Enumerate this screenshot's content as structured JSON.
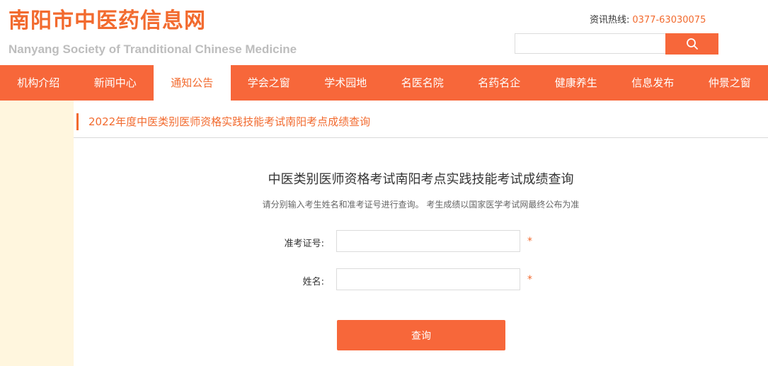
{
  "header": {
    "title": "南阳市中医药信息网",
    "subtitle": "Nanyang Society of Tranditional Chinese Medicine",
    "hotline_label": "资讯热线:",
    "hotline_number": "0377-63030075"
  },
  "search": {
    "value": "",
    "placeholder": "",
    "icon": "search-icon"
  },
  "nav": {
    "items": [
      {
        "label": "机构介绍"
      },
      {
        "label": "新闻中心"
      },
      {
        "label": "通知公告"
      },
      {
        "label": "学会之窗"
      },
      {
        "label": "学术园地"
      },
      {
        "label": "名医名院"
      },
      {
        "label": "名药名企"
      },
      {
        "label": "健康养生"
      },
      {
        "label": "信息发布"
      },
      {
        "label": "仲景之窗"
      }
    ],
    "active": "通知公告"
  },
  "breadcrumb": {
    "title": "2022年度中医类别医师资格实践技能考试南阳考点成绩查询"
  },
  "form": {
    "title": "中医类别医师资格考试南阳考点实践技能考试成绩查询",
    "hint": "请分别输入考生姓名和准考证号进行查询。 考生成绩以国家医学考试网最终公布为准",
    "fields": [
      {
        "label": "准考证号:",
        "value": "",
        "required_mark": "*"
      },
      {
        "label": "姓名:",
        "value": "",
        "required_mark": "*"
      }
    ],
    "submit_label": "查询"
  },
  "colors": {
    "accent": "#f7673a",
    "title_orange": "#f26a2e",
    "sidebar_bg": "#fff6de"
  }
}
